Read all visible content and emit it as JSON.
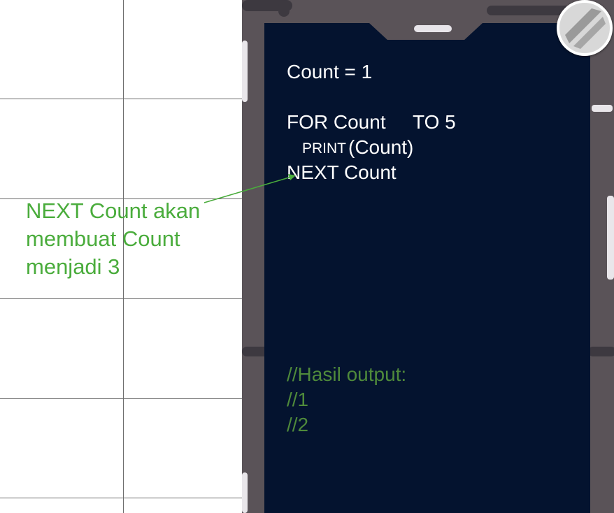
{
  "code": {
    "line1": "Count = 1",
    "line2_for": "FOR Count",
    "line2_to": "TO 5",
    "line3_keyword": "PRINT",
    "line3_arg": "(Count)",
    "line4": "NEXT Count"
  },
  "output": {
    "header": "//Hasil output:",
    "lines": [
      "//1",
      "//2"
    ]
  },
  "annotation": {
    "text": "NEXT Count akan membuat Count menjadi 3",
    "color": "#4aac3c"
  },
  "icons": {
    "corner_button": "slash-circle-icon"
  },
  "colors": {
    "screen": "#04132f",
    "frame": "#5a5358",
    "comment": "#4f8a3b"
  }
}
